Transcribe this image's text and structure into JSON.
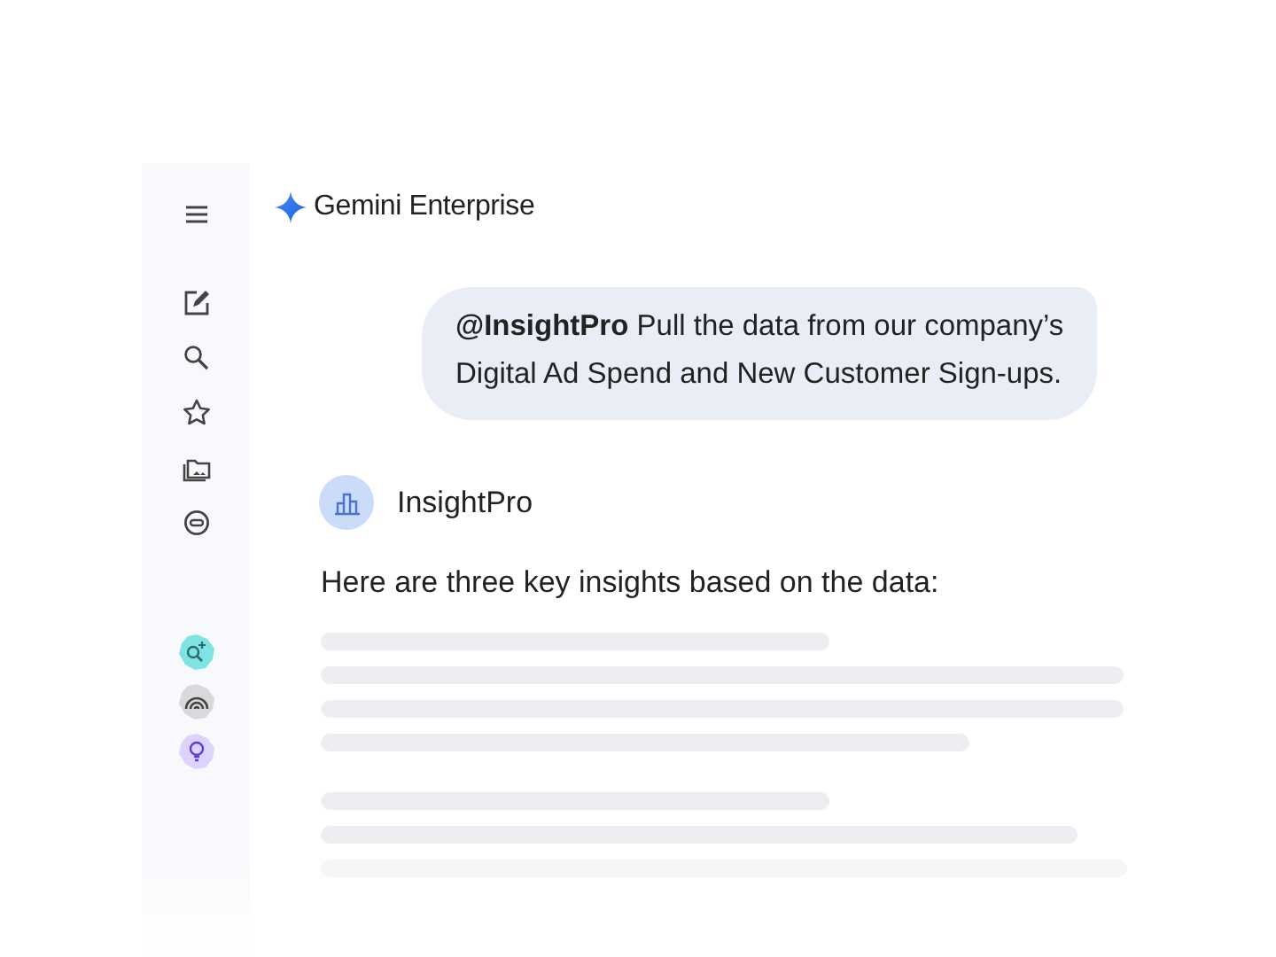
{
  "app": {
    "title": "Gemini Enterprise"
  },
  "agents": [
    {
      "kind": "spark-search",
      "color": "#7fe3e4"
    },
    {
      "kind": "signal",
      "color": "#d8d9db"
    },
    {
      "kind": "bulb",
      "color": "#dcd3ff"
    }
  ],
  "chat": {
    "user_message": {
      "lines": [
        "**@InsightPro** Pull the data from our company’s",
        "Digital Ad Spend and New Customer Sign-ups."
      ]
    },
    "agent": {
      "name": "InsightPro"
    },
    "reply": "Here are three key insights based on the data:"
  }
}
